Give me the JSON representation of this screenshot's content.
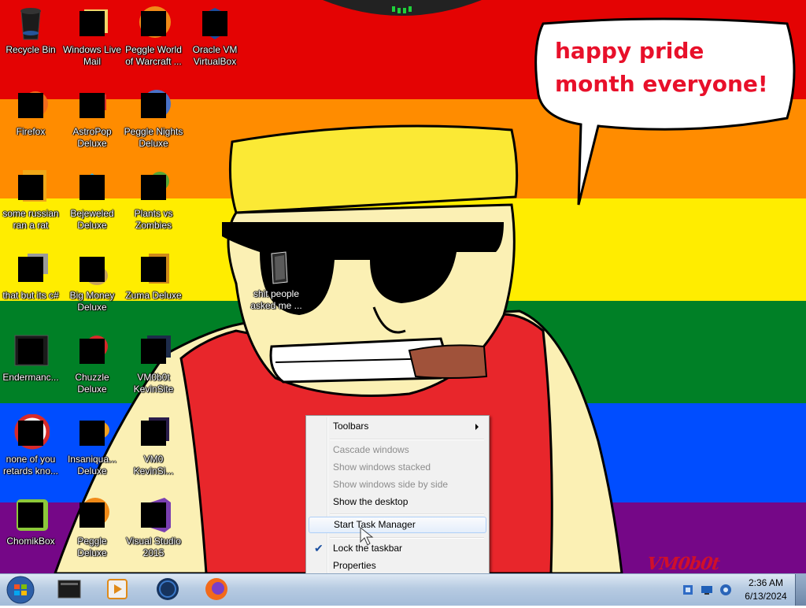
{
  "wallpaper": {
    "speech_bubble": "happy pride month everyone!",
    "signature": "VM0b0t",
    "stripe_colors": [
      "#e40303",
      "#ff8c00",
      "#ffed00",
      "#008026",
      "#004dff",
      "#750787"
    ]
  },
  "desktop_icons": [
    {
      "label": "Recycle Bin",
      "icon": "recycle-bin-icon"
    },
    {
      "label": "Windows Live Mail",
      "icon": "windows-live-mail-icon"
    },
    {
      "label": "Peggle World of Warcraft ...",
      "icon": "peggle-wow-icon"
    },
    {
      "label": "Oracle VM VirtualBox",
      "icon": "virtualbox-icon"
    },
    {
      "label": "Firefox",
      "icon": "firefox-icon"
    },
    {
      "label": "AstroPop Deluxe",
      "icon": "astropop-icon"
    },
    {
      "label": "Peggle Nights Deluxe",
      "icon": "peggle-nights-icon"
    },
    {
      "label": "some russian ran a rat",
      "icon": "shortcut-icon"
    },
    {
      "label": "Bejeweled Deluxe",
      "icon": "bejeweled-icon"
    },
    {
      "label": "Plants vs Zombies",
      "icon": "plants-vs-zombies-icon"
    },
    {
      "label": "that but its c#",
      "icon": "shortcut-icon"
    },
    {
      "label": "Big Money Deluxe",
      "icon": "big-money-icon"
    },
    {
      "label": "Zuma Deluxe",
      "icon": "zuma-icon"
    },
    {
      "label": "Endermanc...",
      "icon": "shortcut-icon"
    },
    {
      "label": "Chuzzle Deluxe",
      "icon": "chuzzle-icon"
    },
    {
      "label": "VM0b0t KevinSite",
      "icon": "shortcut-icon"
    },
    {
      "label": "none of you retards kno...",
      "icon": "shortcut-icon"
    },
    {
      "label": "Insaniqua... Deluxe",
      "icon": "insaniquarium-icon"
    },
    {
      "label": "VM0 KevinSi...",
      "icon": "shortcut-icon"
    },
    {
      "label": "ChomikBox",
      "icon": "chomikbox-icon"
    },
    {
      "label": "Peggle Deluxe",
      "icon": "peggle-icon"
    },
    {
      "label": "Visual Studio 2015",
      "icon": "visual-studio-icon"
    },
    {
      "label": "shit people asked me ...",
      "icon": "folder-icon"
    }
  ],
  "context_menu": {
    "items": [
      {
        "label": "Toolbars",
        "enabled": true,
        "submenu": true
      },
      {
        "label": "Cascade windows",
        "enabled": false
      },
      {
        "label": "Show windows stacked",
        "enabled": false
      },
      {
        "label": "Show windows side by side",
        "enabled": false
      },
      {
        "label": "Show the desktop",
        "enabled": true
      },
      {
        "label": "Start Task Manager",
        "enabled": true,
        "highlighted": true
      },
      {
        "label": "Lock the taskbar",
        "enabled": true,
        "checked": true
      },
      {
        "label": "Properties",
        "enabled": true
      }
    ]
  },
  "taskbar": {
    "pinned": [
      "terminal-icon",
      "media-player-icon",
      "browser-globe-icon",
      "firefox-icon"
    ],
    "tray_icons": [
      "network-icon",
      "display-icon",
      "volume-icon"
    ],
    "clock": {
      "time": "2:36 AM",
      "date": "6/13/2024"
    }
  }
}
